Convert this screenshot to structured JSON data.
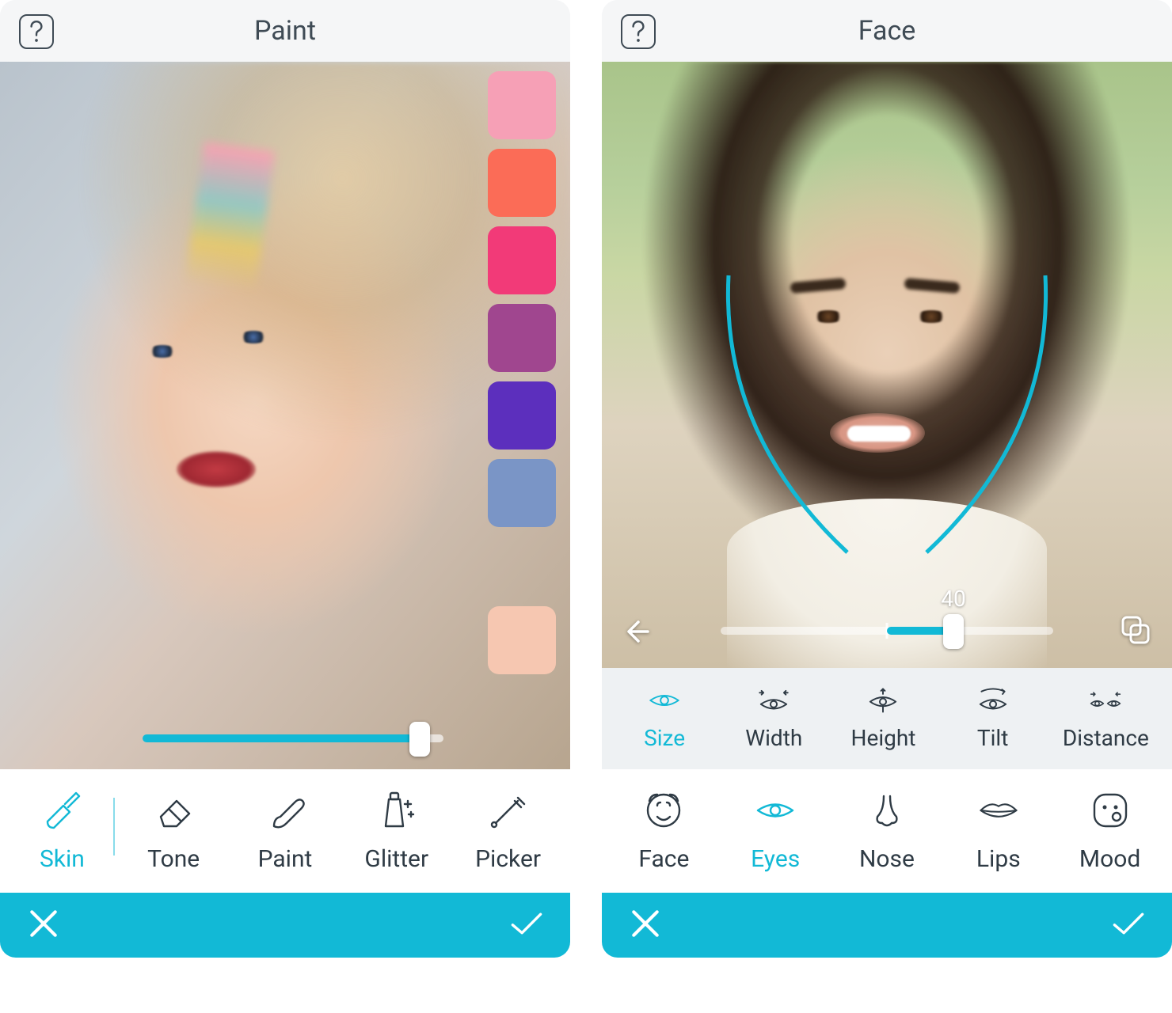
{
  "accent": "#12b9d6",
  "left": {
    "title": "Paint",
    "swatches": [
      "#f6a0b6",
      "#fb6c57",
      "#f23a78",
      "#a0468f",
      "#5c2fbd",
      "#7a95c6"
    ],
    "extra_swatch": "#f6c7b1",
    "slider_pct": 92,
    "tools": [
      {
        "key": "skin",
        "label": "Skin",
        "active": true,
        "icon": "brush-wide"
      },
      {
        "key": "tone",
        "label": "Tone",
        "active": false,
        "icon": "eraser"
      },
      {
        "key": "paint",
        "label": "Paint",
        "active": false,
        "icon": "brush-fine"
      },
      {
        "key": "glitter",
        "label": "Glitter",
        "active": false,
        "icon": "tube-sparkle"
      },
      {
        "key": "picker",
        "label": "Picker",
        "active": false,
        "icon": "eyedropper"
      }
    ]
  },
  "right": {
    "title": "Face",
    "slider_value": "40",
    "slider_pct": 70,
    "sub_options": [
      {
        "key": "size",
        "label": "Size",
        "active": true,
        "icon": "eye"
      },
      {
        "key": "width",
        "label": "Width",
        "active": false,
        "icon": "eye-width"
      },
      {
        "key": "height",
        "label": "Height",
        "active": false,
        "icon": "eye-height"
      },
      {
        "key": "tilt",
        "label": "Tilt",
        "active": false,
        "icon": "eye-tilt"
      },
      {
        "key": "distance",
        "label": "Distance",
        "active": false,
        "icon": "eye-distance"
      }
    ],
    "tools": [
      {
        "key": "face",
        "label": "Face",
        "active": false,
        "icon": "face"
      },
      {
        "key": "eyes",
        "label": "Eyes",
        "active": true,
        "icon": "eye"
      },
      {
        "key": "nose",
        "label": "Nose",
        "active": false,
        "icon": "nose"
      },
      {
        "key": "lips",
        "label": "Lips",
        "active": false,
        "icon": "lips"
      },
      {
        "key": "mood",
        "label": "Mood",
        "active": false,
        "icon": "mood"
      }
    ]
  }
}
